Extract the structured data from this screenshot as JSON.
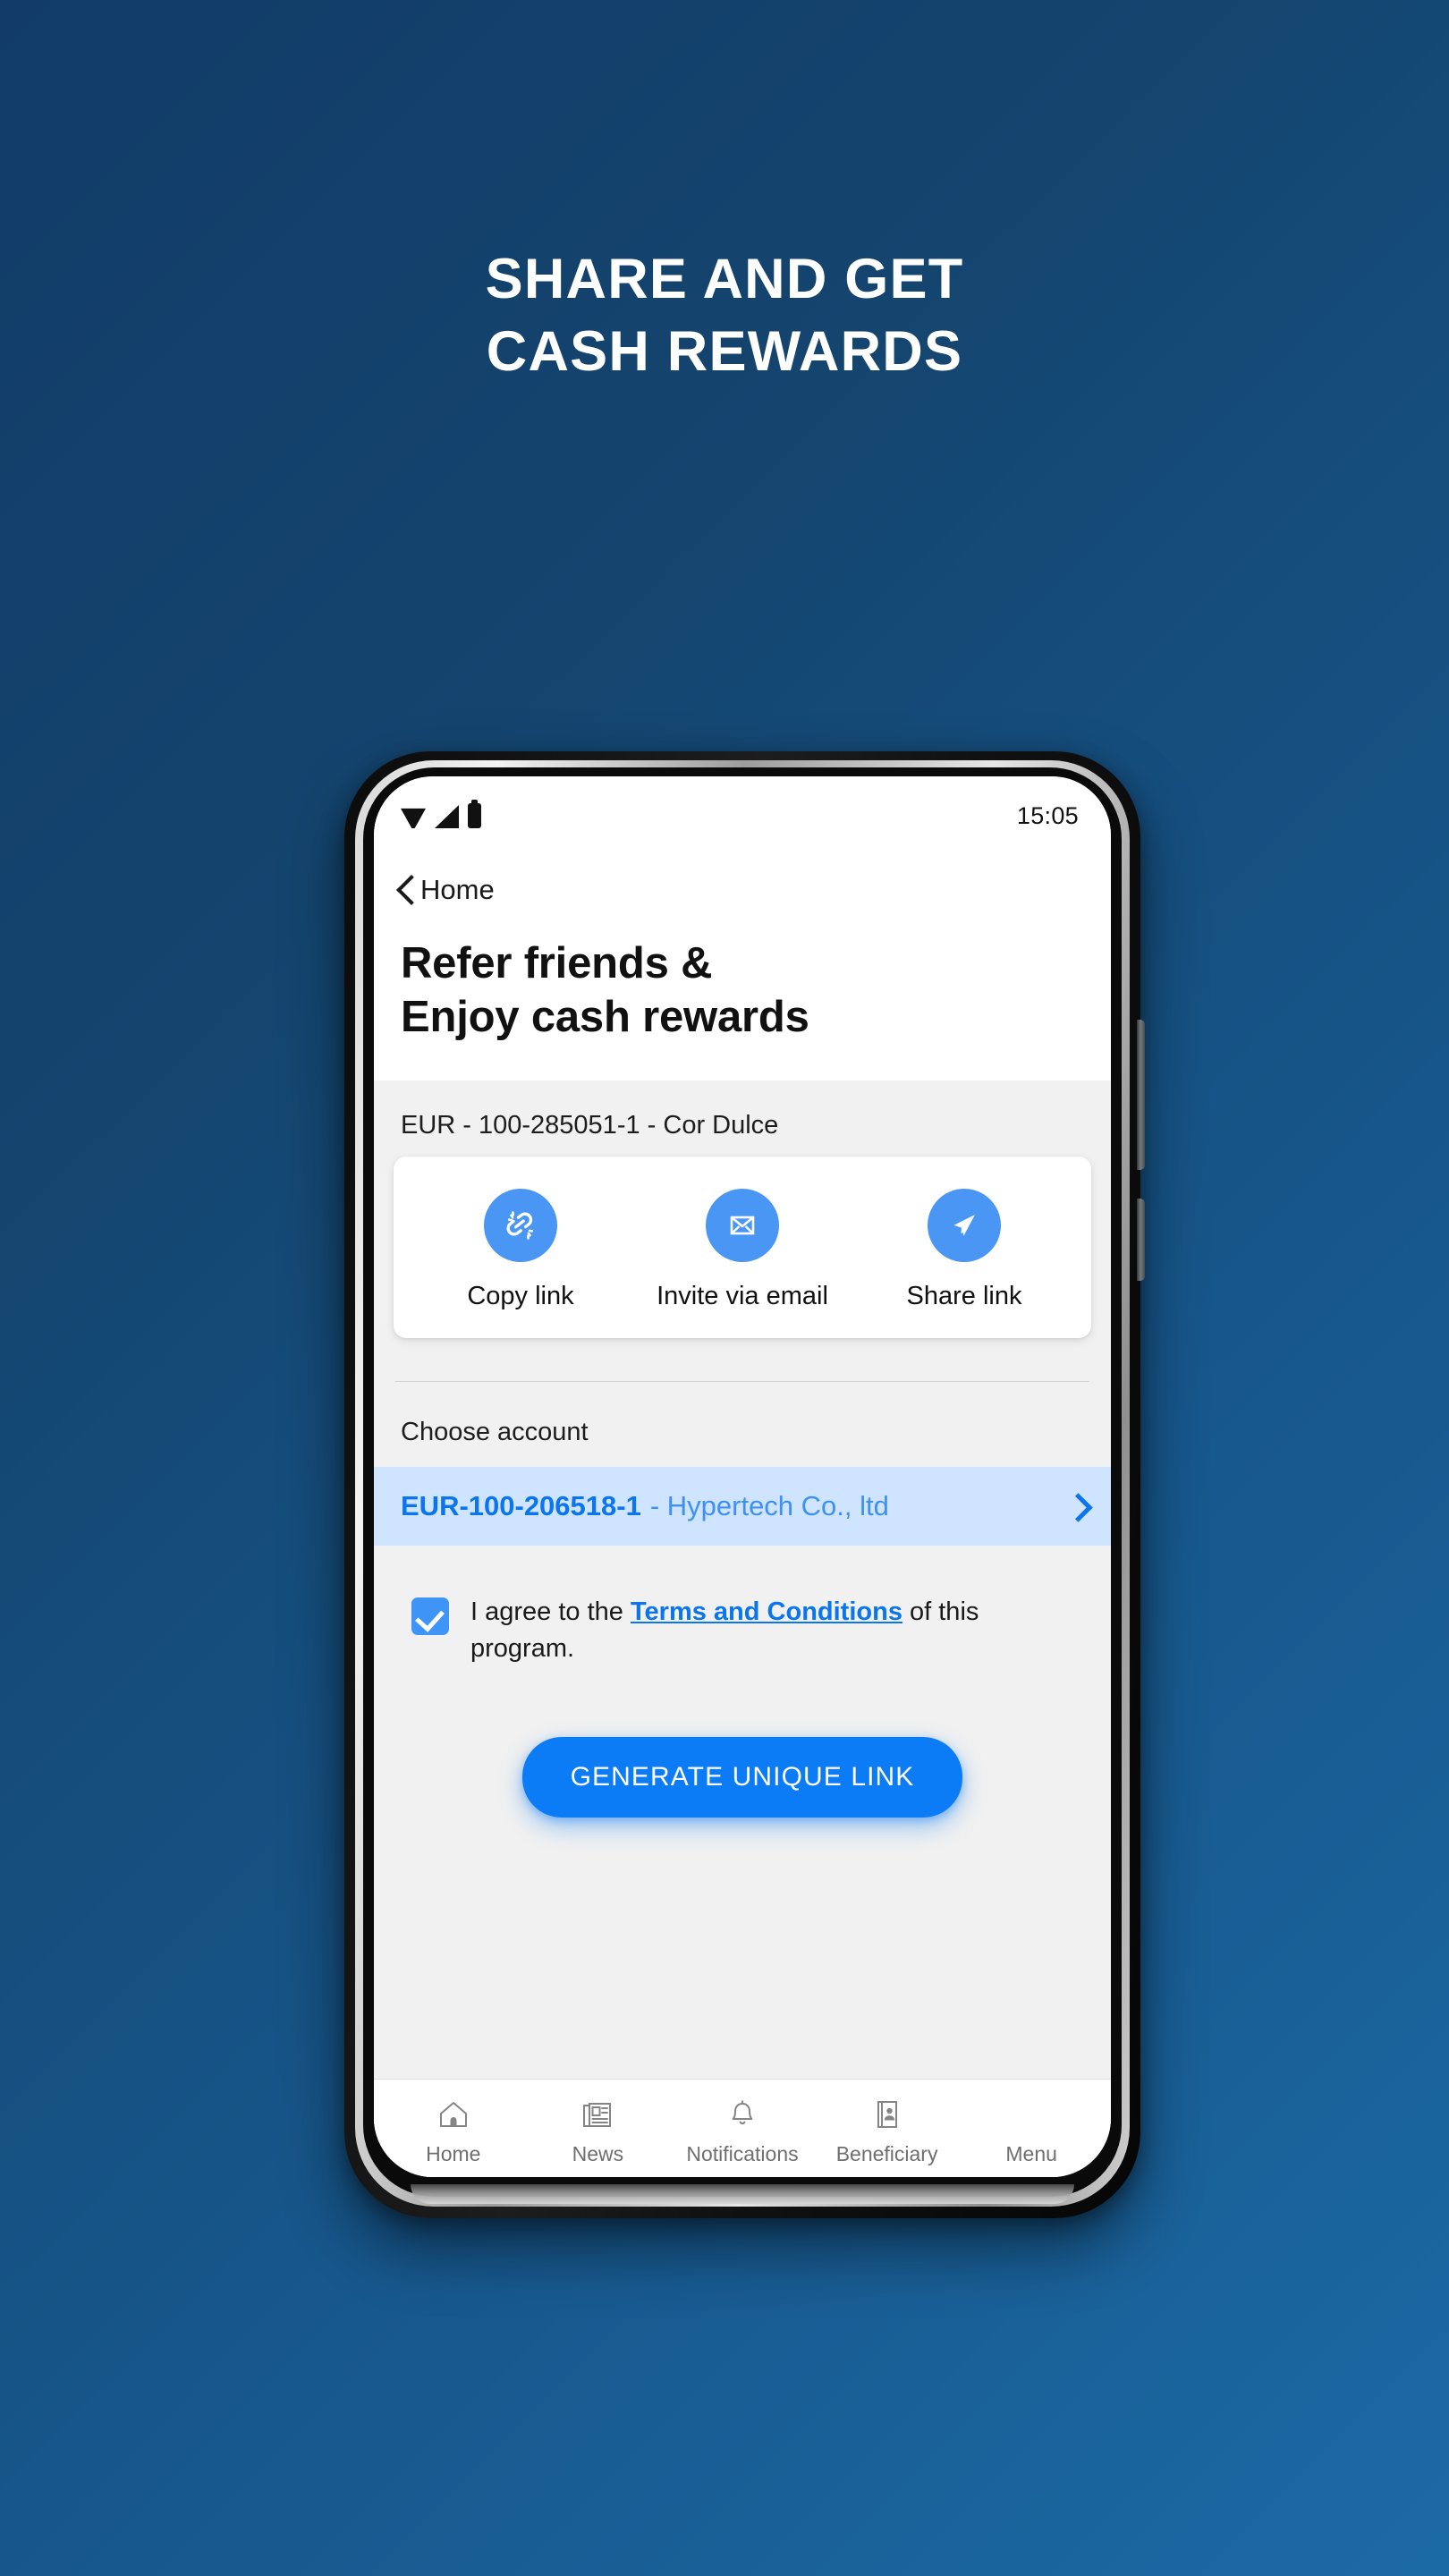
{
  "poster": {
    "headline_lines": [
      "SHARE AND GET",
      "CASH REWARDS"
    ],
    "background_color_top": "#123b69",
    "background_color_bottom": "#1c6aa5"
  },
  "phone": {
    "statusbar": {
      "time": "15:05",
      "icons": [
        "wifi-icon",
        "signal-icon",
        "battery-icon"
      ]
    },
    "navback": {
      "icon": "chevron-left-icon",
      "label": "Home"
    },
    "page_title_lines": [
      "Refer friends &",
      "Enjoy cash rewards"
    ],
    "account_line": "EUR - 100-285051-1 - Cor Dulce",
    "share_actions": [
      {
        "icon": "link-icon",
        "label": "Copy link"
      },
      {
        "icon": "envelope-icon",
        "label": "Invite via email"
      },
      {
        "icon": "paper-plane-icon",
        "label": "Share link"
      }
    ],
    "choose_account_label": "Choose account",
    "selected_account": {
      "number": "EUR-100-206518-1",
      "separator": " - ",
      "name": "Hypertech Co., ltd",
      "chevron": "chevron-right-icon"
    },
    "terms": {
      "checked": true,
      "text_before": "I agree to the ",
      "link_text": "Terms and Conditions",
      "text_after": " of this program."
    },
    "cta_label": "GENERATE UNIQUE LINK",
    "bottom_nav": [
      {
        "icon": "home-icon",
        "label": "Home"
      },
      {
        "icon": "news-icon",
        "label": "News"
      },
      {
        "icon": "bell-icon",
        "label": "Notifications"
      },
      {
        "icon": "id-card-icon",
        "label": "Beneficiary"
      },
      {
        "icon": "menu-icon",
        "label": "Menu"
      }
    ],
    "accent_color": "#0b7cf5",
    "icon_circle_color": "#4a96f5",
    "highlight_row_color": "#cfe4ff"
  }
}
